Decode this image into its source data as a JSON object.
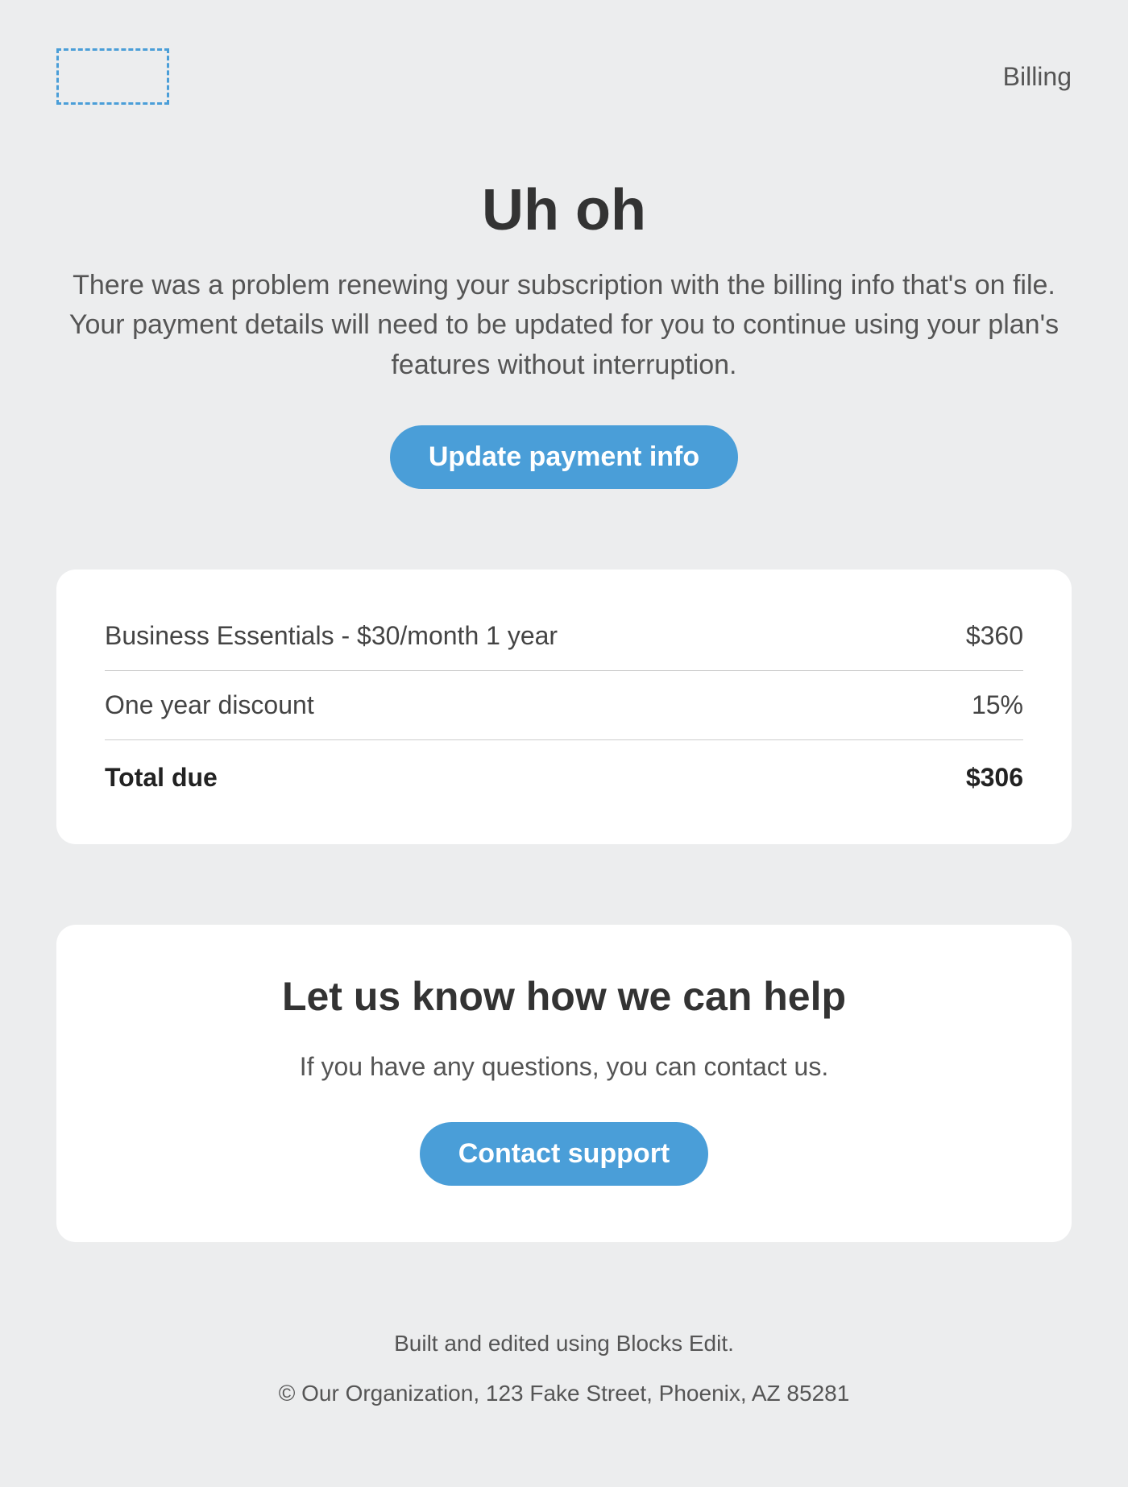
{
  "header": {
    "label": "Billing"
  },
  "hero": {
    "title": "Uh oh",
    "body": "There was a problem renewing your subscription with the billing info that's on file. Your payment details will need to be updated for you to continue using your plan's features without interruption.",
    "cta_label": "Update payment info"
  },
  "billing": {
    "items": [
      {
        "label": "Business Essentials - $30/month 1 year",
        "value": "$360"
      },
      {
        "label": "One year discount",
        "value": "15%"
      }
    ],
    "total_label": "Total due",
    "total_value": "$306"
  },
  "help": {
    "title": "Let us know how we can help",
    "body": "If you have any questions, you can contact us.",
    "cta_label": "Contact support"
  },
  "footer": {
    "line1": "Built and edited using Blocks Edit.",
    "line2": "© Our Organization, 123 Fake Street, Phoenix, AZ 85281"
  },
  "colors": {
    "accent": "#4a9ed8",
    "background": "#ecedee"
  }
}
